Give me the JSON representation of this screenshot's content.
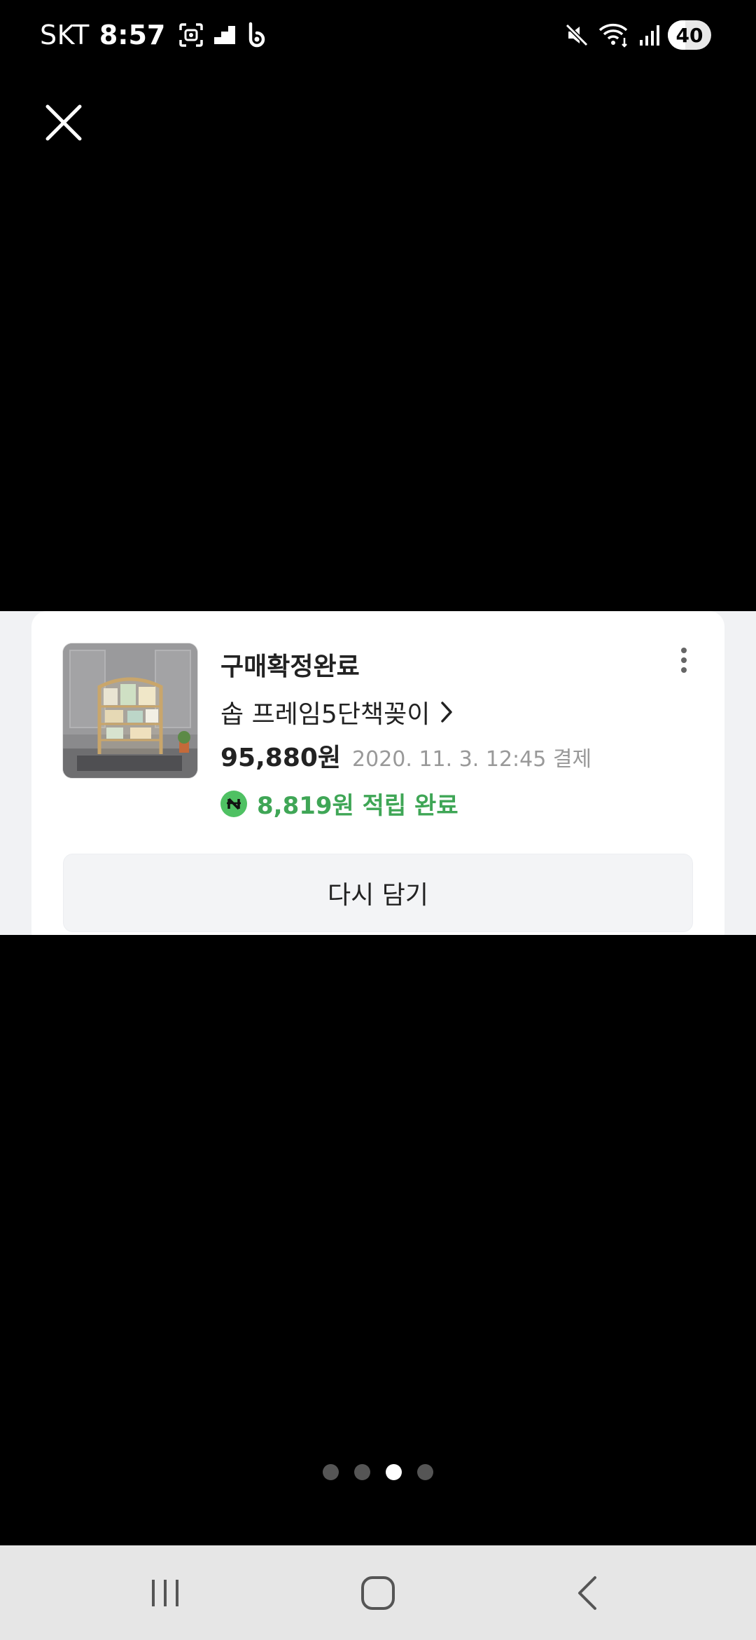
{
  "status_bar": {
    "carrier": "SKT",
    "time": "8:57",
    "battery": "40",
    "battery_level": 0.4,
    "left_icons": [
      "screenshot-icon",
      "stairs-icon",
      "b-app-icon"
    ],
    "right_icons": [
      "mute-icon",
      "wifi-icon",
      "signal-icon"
    ]
  },
  "order_card": {
    "status": "구매확정완료",
    "product_name": "솝 프레임5단책꽂이",
    "price": "95,880원",
    "date": "2020. 11. 3. 12:45 결제",
    "reward": "8,819원 적립 완료",
    "action_label": "다시 담기"
  },
  "pagination": {
    "total": 4,
    "active": 3
  },
  "colors": {
    "background": "#000000",
    "panel": "#f1f2f4",
    "reward_green": "#3fa656",
    "badge_green": "#4fc163"
  }
}
